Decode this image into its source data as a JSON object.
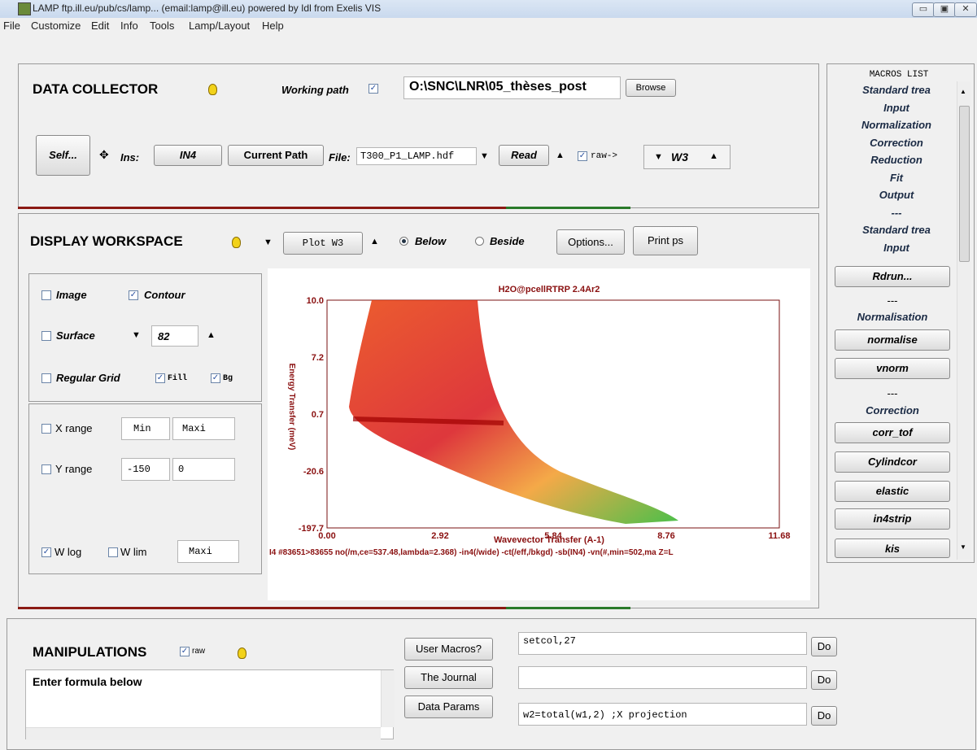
{
  "window": {
    "title": "LAMP ftp.ill.eu/pub/cs/lamp... (email:lamp@ill.eu)    powered by Idl from Exelis VIS",
    "min": "▭",
    "max": "▣",
    "close": "✕"
  },
  "menu": [
    "File",
    "Customize",
    "Edit",
    "Info",
    "Tools",
    "Lamp/Layout",
    "Help"
  ],
  "collector": {
    "title": "DATA COLLECTOR",
    "working_path_label": "Working path",
    "path": "O:\\SNC\\LNR\\05_thèses_post",
    "browse": "Browse",
    "self": "Self...",
    "ins_label": "Ins:",
    "ins_value": "IN4",
    "current_path": "Current Path",
    "file_label": "File:",
    "file_value": "T300_P1_LAMP.hdf",
    "read": "Read",
    "raw": "raw->",
    "workspace": "W3"
  },
  "display": {
    "title": "DISPLAY WORKSPACE",
    "plot": "Plot W3",
    "below": "Below",
    "beside": "Beside",
    "options": "Options...",
    "print": "Print ps",
    "image": "Image",
    "contour": "Contour",
    "surface": "Surface",
    "surface_value": "82",
    "regular_grid": "Regular Grid",
    "fill": "Fill",
    "bg": "Bg",
    "xrange": "X range",
    "xmin": "Min",
    "xmax": "Maxi",
    "yrange": "Y range",
    "ymin": "-150",
    "ymax": "0",
    "wlog": "W log",
    "wlim": "W lim",
    "wlim_value": "Maxi"
  },
  "chart_data": {
    "type": "heatmap",
    "title": "H2O@pcellRTRP 2.4Ar2",
    "xlabel": "Wavevector Transfer (A-1)",
    "ylabel": "Energy Transfer (meV)",
    "x_ticks": [
      "0.00",
      "2.92",
      "5.84",
      "8.76",
      "11.68"
    ],
    "y_ticks": [
      "10.0",
      "7.2",
      "0.7",
      "-20.6",
      "-197.7"
    ],
    "xlim": [
      0,
      11.68
    ],
    "ylim": [
      -197.7,
      10.0
    ],
    "footer": "I4 #83651>83655 no(/m,ce=537.48,lambda=2.368) -in4(/wide) -ct(/eff,/bkgd) -sb(IN4) -vn(#,min=502,ma Z=L",
    "colors": {
      "low": "#22b422",
      "mid": "#e08a14",
      "high": "#c80a0a"
    }
  },
  "manip": {
    "title": "MANIPULATIONS",
    "raw": "raw",
    "formula_title": "Enter formula below",
    "user_macros": "User Macros?",
    "journal": "The Journal",
    "params": "Data Params",
    "cmd1": "setcol,27",
    "cmd2": "",
    "cmd3": "w2=total(w1,2) ;X projection",
    "do": "Do"
  },
  "macros": {
    "header": "MACROS LIST",
    "list": [
      "Standard trea",
      "Input",
      "Normalization",
      "Correction",
      "Reduction",
      "Fit",
      "Output",
      "---",
      "Standard trea",
      "Input"
    ],
    "rdrun": "Rdrun...",
    "sep": "---",
    "normalisation": "Normalisation",
    "normalise": "normalise",
    "vnorm": "vnorm",
    "correction": "Correction",
    "corr_tof": "corr_tof",
    "cylindcor": "Cylindcor",
    "elastic": "elastic",
    "in4strip": "in4strip",
    "kis": "kis"
  }
}
